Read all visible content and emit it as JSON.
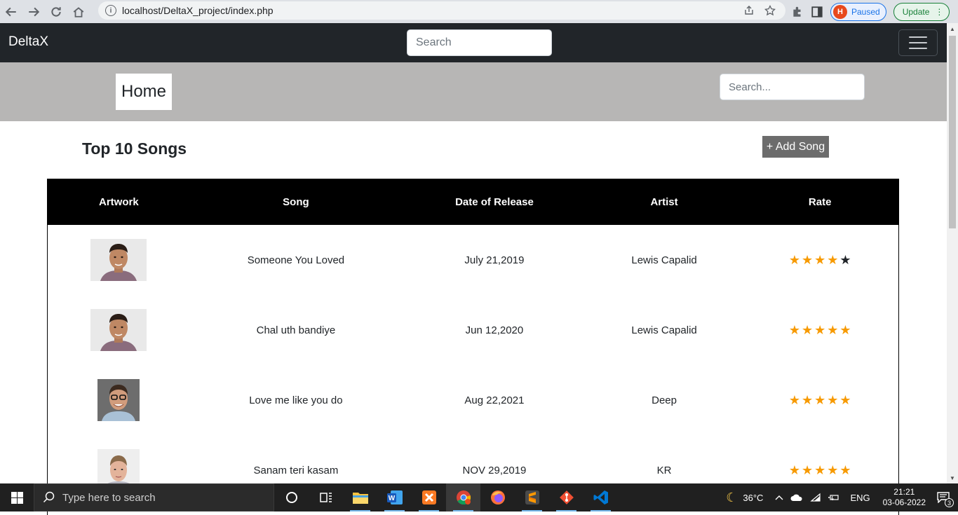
{
  "browser": {
    "url": "localhost/DeltaX_project/index.php",
    "profile_status": "Paused",
    "profile_initial": "H",
    "update_label": "Update"
  },
  "navbar": {
    "brand": "DeltaX",
    "search_placeholder": "Search"
  },
  "header": {
    "home_label": "Home",
    "search_placeholder": "Search..."
  },
  "main": {
    "title": "Top 10 Songs",
    "add_button": "+ Add Song",
    "columns": [
      "Artwork",
      "Song",
      "Date of Release",
      "Artist",
      "Rate"
    ],
    "rows": [
      {
        "song": "Someone You Loved",
        "date": "July 21,2019",
        "artist": "Lewis Capalid",
        "rating": 4
      },
      {
        "song": "Chal uth bandiye",
        "date": "Jun 12,2020",
        "artist": "Lewis Capalid",
        "rating": 5
      },
      {
        "song": "Love me like you do",
        "date": "Aug 22,2021",
        "artist": "Deep",
        "rating": 5
      },
      {
        "song": "Sanam teri kasam",
        "date": "NOV 29,2019",
        "artist": "KR",
        "rating": 5
      }
    ]
  },
  "taskbar": {
    "search_placeholder": "Type here to search",
    "weather": "36°C",
    "language": "ENG",
    "time": "21:21",
    "date": "03-06-2022",
    "notification_count": "3"
  }
}
